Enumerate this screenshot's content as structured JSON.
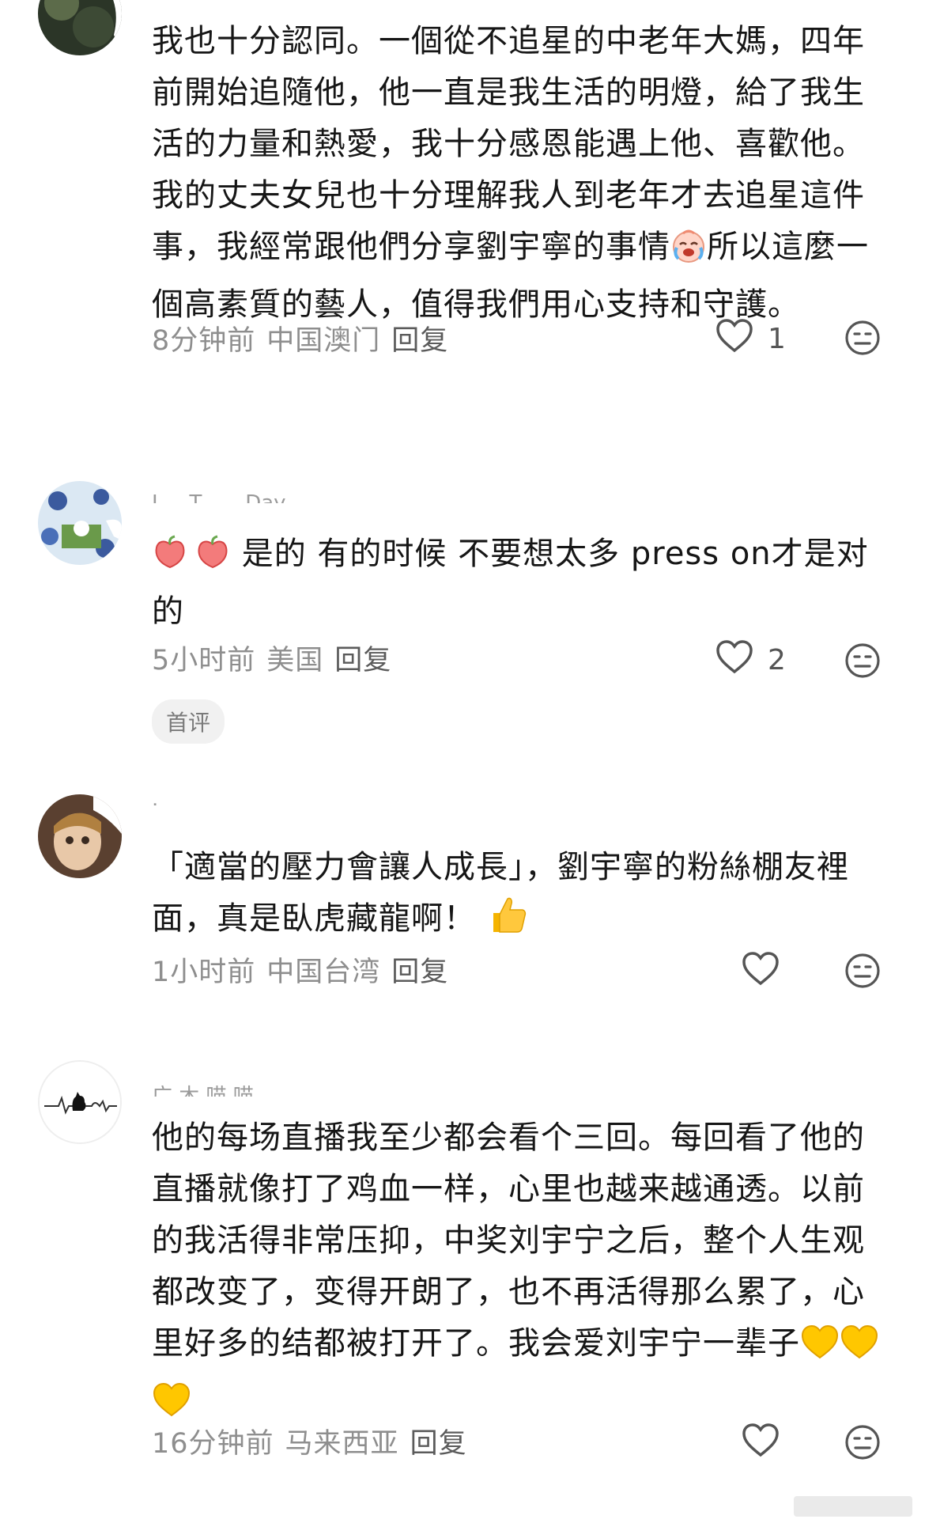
{
  "comments": [
    {
      "username": "",
      "text": "我也十分認同。一個從不追星的中老年大媽，四年前開始追隨他，他一直是我生活的明燈，給了我生活的力量和熱愛，我十分感恩能遇上他、喜歡他。我的丈夫女兒也十分理解我人到老年才去追星這件事，我經常跟他們分享劉宇寧的事情",
      "text_after_emoji": "所以這麼一個高素質的藝人，值得我們用心支持和守護。",
      "time": "8分钟前",
      "location": "中国澳门",
      "reply": "回复",
      "likes": "1",
      "emoji": "crying-laughing-face"
    },
    {
      "username": "L... T... ...Day",
      "text": "是的 有的时候 不要想太多 press on才是对的",
      "time": "5小时前",
      "location": "美国",
      "reply": "回复",
      "likes": "2",
      "badge": "首评",
      "emoji": "peach-hearts"
    },
    {
      "username": "·",
      "text": "「適當的壓力會讓人成長」，劉宇寧的粉絲棚友裡面，真是臥虎藏龍啊！",
      "time": "1小时前",
      "location": "中国台湾",
      "reply": "回复",
      "likes": "",
      "emoji": "thumbs-up"
    },
    {
      "username": "广 木 喵 喵",
      "text": "他的每场直播我至少都会看个三回。每回看了他的直播就像打了鸡血一样，心里也越来越通透。以前的我活得非常压抑，中奖刘宇宁之后，整个人生观都改变了，变得开朗了，也不再活得那么累了，心里好多的结都被打开了。我会爱刘宇宁一辈子",
      "time": "16分钟前",
      "location": "马来西亚",
      "reply": "回复",
      "likes": "",
      "emoji": "yellow-hearts"
    }
  ],
  "colors": {
    "text": "#161616",
    "meta": "#8e8e8e",
    "icon": "#555555",
    "emoji_yellow": "#f5b400",
    "emoji_peach": "#f05a5a"
  }
}
